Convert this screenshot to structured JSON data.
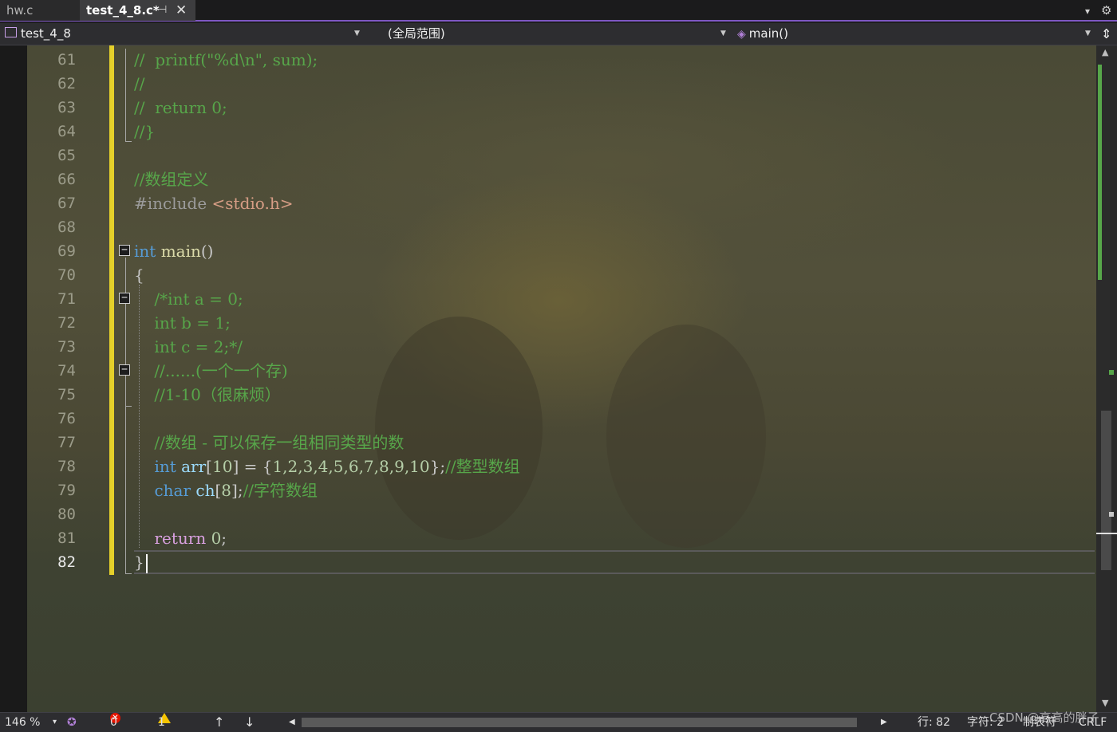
{
  "tabs": [
    {
      "label": "hw.c",
      "active": false
    },
    {
      "label": "test_4_8.c*",
      "active": true,
      "pin": "⊣",
      "close": "✕"
    }
  ],
  "toolbar_icons": {
    "dropdown": "▾",
    "settings": "⚙"
  },
  "nav": {
    "project": "test_4_8",
    "scope": "(全局范围)",
    "member": "main()",
    "split": "⇕"
  },
  "editor": {
    "lines": [
      {
        "n": "61",
        "tokens": [
          {
            "t": "//  printf(\"%d\\n\", sum);",
            "c": "c-comment"
          }
        ]
      },
      {
        "n": "62",
        "tokens": [
          {
            "t": "//",
            "c": "c-comment"
          }
        ]
      },
      {
        "n": "63",
        "tokens": [
          {
            "t": "//  return 0;",
            "c": "c-comment"
          }
        ]
      },
      {
        "n": "64",
        "tokens": [
          {
            "t": "//}",
            "c": "c-comment"
          }
        ]
      },
      {
        "n": "65",
        "tokens": []
      },
      {
        "n": "66",
        "tokens": [
          {
            "t": "//数组定义",
            "c": "c-comment"
          }
        ]
      },
      {
        "n": "67",
        "tokens": [
          {
            "t": "#include ",
            "c": "c-pp"
          },
          {
            "t": "<stdio.h>",
            "c": "c-str"
          }
        ]
      },
      {
        "n": "68",
        "tokens": []
      },
      {
        "n": "69",
        "tokens": [
          {
            "t": "int",
            "c": "c-kw"
          },
          {
            "t": " ",
            "c": "c-txt"
          },
          {
            "t": "main",
            "c": "c-fn"
          },
          {
            "t": "()",
            "c": "c-txt"
          }
        ]
      },
      {
        "n": "70",
        "tokens": [
          {
            "t": "{",
            "c": "c-txt"
          }
        ]
      },
      {
        "n": "71",
        "tokens": [
          {
            "t": "    /*int a = 0;",
            "c": "c-comment"
          }
        ]
      },
      {
        "n": "72",
        "tokens": [
          {
            "t": "    int b = 1;",
            "c": "c-comment"
          }
        ]
      },
      {
        "n": "73",
        "tokens": [
          {
            "t": "    int c = 2;*/",
            "c": "c-comment"
          }
        ]
      },
      {
        "n": "74",
        "tokens": [
          {
            "t": "    //......(一个一个存)",
            "c": "c-comment"
          }
        ]
      },
      {
        "n": "75",
        "tokens": [
          {
            "t": "    //1-10（很麻烦）",
            "c": "c-comment"
          }
        ]
      },
      {
        "n": "76",
        "tokens": []
      },
      {
        "n": "77",
        "tokens": [
          {
            "t": "    //数组 - 可以保存一组相同类型的数",
            "c": "c-comment"
          }
        ]
      },
      {
        "n": "78",
        "tokens": [
          {
            "t": "    ",
            "c": "c-txt"
          },
          {
            "t": "int",
            "c": "c-kw"
          },
          {
            "t": " ",
            "c": "c-txt"
          },
          {
            "t": "arr",
            "c": "c-var"
          },
          {
            "t": "[",
            "c": "c-txt"
          },
          {
            "t": "10",
            "c": "c-num"
          },
          {
            "t": "] = {",
            "c": "c-txt"
          },
          {
            "t": "1,2,3,4,5,6,7,8,9,10",
            "c": "c-num"
          },
          {
            "t": "};",
            "c": "c-txt"
          },
          {
            "t": "//整型数组",
            "c": "c-comment"
          }
        ]
      },
      {
        "n": "79",
        "tokens": [
          {
            "t": "    ",
            "c": "c-txt"
          },
          {
            "t": "char",
            "c": "c-kw"
          },
          {
            "t": " ",
            "c": "c-txt"
          },
          {
            "t": "ch",
            "c": "c-var"
          },
          {
            "t": "[",
            "c": "c-txt"
          },
          {
            "t": "8",
            "c": "c-num"
          },
          {
            "t": "];",
            "c": "c-txt"
          },
          {
            "t": "//字符数组",
            "c": "c-comment"
          }
        ]
      },
      {
        "n": "80",
        "tokens": []
      },
      {
        "n": "81",
        "tokens": [
          {
            "t": "    ",
            "c": "c-txt"
          },
          {
            "t": "return",
            "c": "c-ctrl"
          },
          {
            "t": " ",
            "c": "c-txt"
          },
          {
            "t": "0",
            "c": "c-num"
          },
          {
            "t": ";",
            "c": "c-txt"
          }
        ]
      },
      {
        "n": "82",
        "tokens": [
          {
            "t": "}",
            "c": "c-txt"
          }
        ],
        "current": true
      }
    ],
    "fold_glyph": "−"
  },
  "scrollbar": {
    "up": "▲",
    "down": "▼"
  },
  "status": {
    "zoom": "146 %",
    "zoom_arrow": "▾",
    "errors": "0",
    "error_glyph": "✕",
    "warnings": "1",
    "nav_up": "↑",
    "nav_down": "↓",
    "scroll_left": "◀",
    "scroll_right": "▶",
    "line": "行: 82",
    "char": "字符: 2",
    "indent": "制表符",
    "eol": "CRLF",
    "watermark": "CSDN @高高的胖子"
  }
}
